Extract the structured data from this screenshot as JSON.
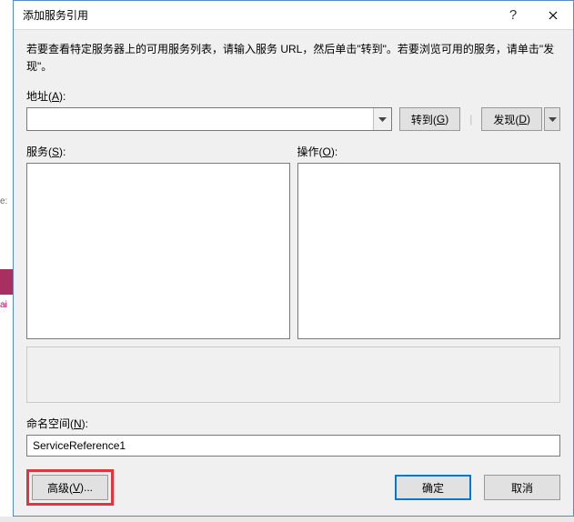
{
  "title": "添加服务引用",
  "instruction": "若要查看特定服务器上的可用服务列表，请输入服务 URL，然后单击\"转到\"。若要浏览可用的服务，请单击\"发现\"。",
  "address": {
    "label_pre": "地址(",
    "label_acc": "A",
    "label_post": "):",
    "value": ""
  },
  "buttons": {
    "go_pre": "转到(",
    "go_acc": "G",
    "go_post": ")",
    "discover_pre": "发现(",
    "discover_acc": "D",
    "discover_post": ")",
    "advanced_pre": "高级(",
    "advanced_acc": "V",
    "advanced_post": ")...",
    "ok": "确定",
    "cancel": "取消"
  },
  "services": {
    "label_pre": "服务(",
    "label_acc": "S",
    "label_post": "):"
  },
  "operations": {
    "label_pre": "操作(",
    "label_acc": "O",
    "label_post": "):"
  },
  "namespace": {
    "label_pre": "命名空间(",
    "label_acc": "N",
    "label_post": "):",
    "value": "ServiceReference1"
  },
  "status": ""
}
